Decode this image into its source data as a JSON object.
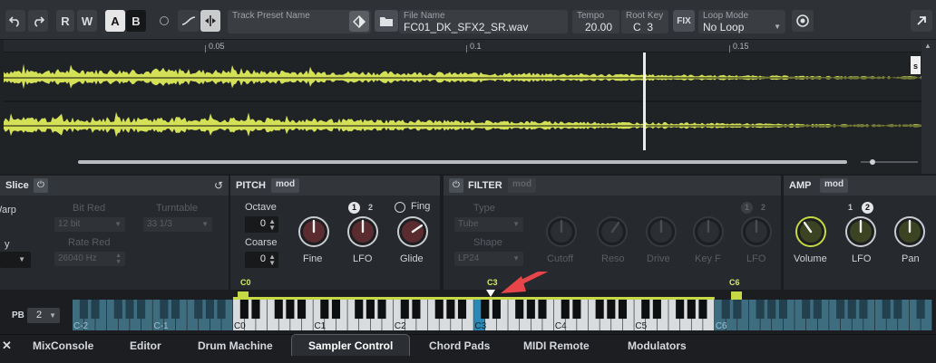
{
  "toolbar": {
    "r_label": "R",
    "w_label": "W",
    "a_label": "A",
    "b_label": "B",
    "track_preset_label": "Track Preset Name",
    "file_name_label": "File Name",
    "file_name_value": "FC01_DK_SFX2_SR.wav",
    "tempo_label": "Tempo",
    "tempo_value": "20.00",
    "root_key_label": "Root Key",
    "root_key_value": "C  3",
    "fix_label": "FIX",
    "loop_mode_label": "Loop Mode",
    "loop_mode_value": "No Loop"
  },
  "ruler": {
    "ticks": [
      "0.05",
      "0.1",
      "0.15"
    ]
  },
  "slice_panel": {
    "title": "Slice",
    "warp_label": "Warp",
    "bit_red_label": "Bit Red",
    "bit_red_value": "12 bit",
    "turntable_label": "Turntable",
    "turntable_value": "33 1/3",
    "rate_red_label": "Rate Red",
    "rate_red_value": "26040 Hz",
    "y_label": "y"
  },
  "pitch_panel": {
    "title": "PITCH",
    "mod_label": "mod",
    "octave_label": "Octave",
    "octave_value": "0",
    "coarse_label": "Coarse",
    "coarse_value": "0",
    "fine_label": "Fine",
    "lfo_label": "LFO",
    "glide_label": "Glide",
    "fing_label": "Fing",
    "lfo1": "1",
    "lfo2": "2"
  },
  "filter_panel": {
    "title": "FILTER",
    "mod_label": "mod",
    "type_label": "Type",
    "type_value": "Tube",
    "shape_label": "Shape",
    "shape_value": "LP24",
    "cutoff_label": "Cutoff",
    "reso_label": "Reso",
    "drive_label": "Drive",
    "keyf_label": "Key F",
    "lfo_label": "LFO",
    "lfo1": "1",
    "lfo2": "2"
  },
  "amp_panel": {
    "title": "AMP",
    "mod_label": "mod",
    "volume_label": "Volume",
    "lfo_label": "LFO",
    "pan_label": "Pan",
    "lfo1": "1",
    "lfo2": "2"
  },
  "keyboard": {
    "pb_label": "PB",
    "pb_value": "2",
    "range_low": "C0",
    "root": "C3",
    "range_high": "C6",
    "octave_labels": [
      "C-2",
      "C-1",
      "C0",
      "C1",
      "C2",
      "C3",
      "C4",
      "C5",
      "C6"
    ]
  },
  "tabs": [
    "MixConsole",
    "Editor",
    "Drum Machine",
    "Sampler Control",
    "Chord Pads",
    "MIDI Remote",
    "Modulators"
  ],
  "active_tab": "Sampler Control",
  "colors": {
    "waveform": "#d4e157",
    "accent": "#c6d945",
    "arrow": "#e8454a",
    "root_key": "#2a8ab7"
  }
}
